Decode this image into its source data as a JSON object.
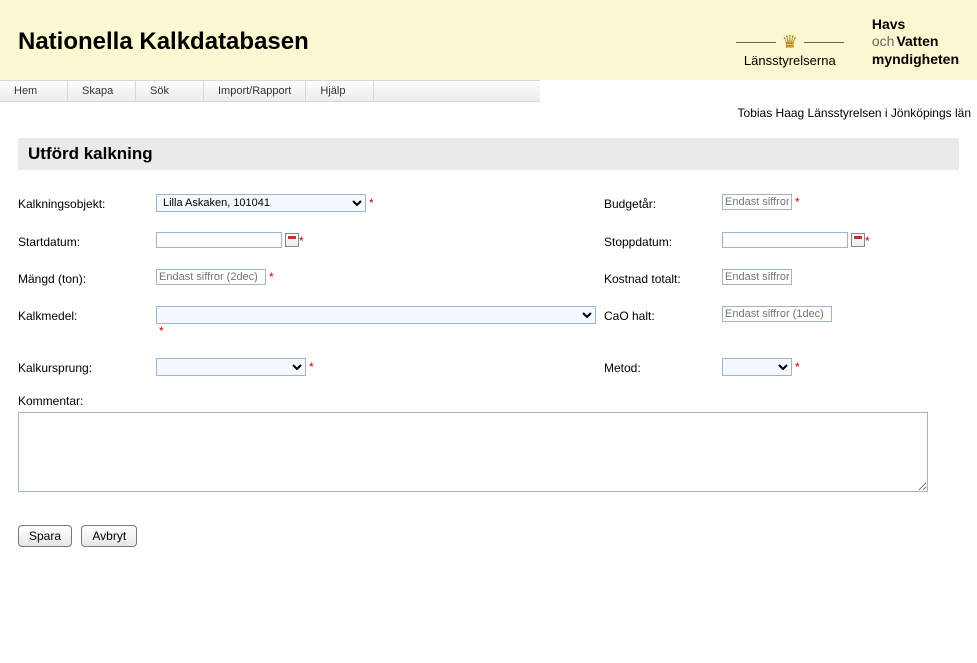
{
  "header": {
    "title": "Nationella Kalkdatabasen",
    "logo_lans": "Länsstyrelserna",
    "logo_hav_line1": "Havs",
    "logo_hav_och": "och",
    "logo_hav_line2": "Vatten",
    "logo_hav_line3": "myndigheten"
  },
  "menu": {
    "hem": "Hem",
    "skapa": "Skapa",
    "sok": "Sök",
    "import": "Import/Rapport",
    "hjalp": "Hjälp"
  },
  "user_line": "Tobias Haag Länsstyrelsen i Jönköpings län",
  "section_title": "Utförd kalkning",
  "labels": {
    "kalkningsobjekt": "Kalkningsobjekt:",
    "budgetar": "Budgetår:",
    "startdatum": "Startdatum:",
    "stoppdatum": "Stoppdatum:",
    "mangd": "Mängd (ton):",
    "kostnad": "Kostnad totalt:",
    "kalkmedel": "Kalkmedel:",
    "cao": "CaO halt:",
    "kalkursprung": "Kalkursprung:",
    "metod": "Metod:",
    "kommentar": "Kommentar:"
  },
  "fields": {
    "kalkningsobjekt_value": "Lilla Askaken, 101041",
    "budgetar_placeholder": "Endast siffror",
    "startdatum_value": "",
    "stoppdatum_value": "",
    "mangd_placeholder": "Endast siffror (2dec)",
    "kostnad_placeholder": "Endast siffror",
    "kalkmedel_value": "",
    "cao_placeholder": "Endast siffror (1dec)",
    "kalkursprung_value": "",
    "metod_value": "",
    "kommentar_value": ""
  },
  "req_mark": "*",
  "buttons": {
    "spara": "Spara",
    "avbryt": "Avbryt"
  }
}
